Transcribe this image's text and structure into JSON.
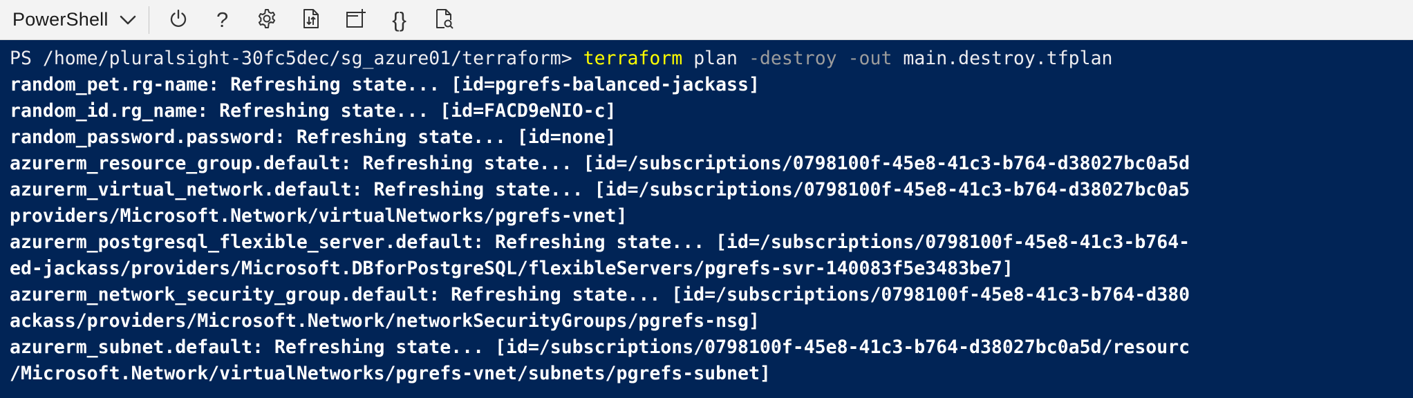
{
  "toolbar": {
    "shell_selector": "PowerShell",
    "buttons": [
      {
        "name": "restart-icon",
        "glyph": "power"
      },
      {
        "name": "help-icon",
        "glyph": "?"
      },
      {
        "name": "settings-icon",
        "glyph": "gear"
      },
      {
        "name": "upload-download-icon",
        "glyph": "file-transfer"
      },
      {
        "name": "new-session-icon",
        "glyph": "new-tab"
      },
      {
        "name": "editor-icon",
        "glyph": "{}"
      },
      {
        "name": "web-preview-icon",
        "glyph": "preview"
      }
    ]
  },
  "terminal": {
    "prompt": "PS /home/pluralsight-30fc5dec/sg_azure01/terraform> ",
    "command": {
      "name": "terraform",
      "arg1": " plan ",
      "flag1": "-destroy",
      "space": " ",
      "flag2": "-out",
      "arg2": " main.destroy.tfplan"
    },
    "lines": [
      "random_pet.rg-name: Refreshing state... [id=pgrefs-balanced-jackass]",
      "random_id.rg_name: Refreshing state... [id=FACD9eNIO-c]",
      "random_password.password: Refreshing state... [id=none]",
      "azurerm_resource_group.default: Refreshing state... [id=/subscriptions/0798100f-45e8-41c3-b764-d38027bc0a5d",
      "azurerm_virtual_network.default: Refreshing state... [id=/subscriptions/0798100f-45e8-41c3-b764-d38027bc0a5",
      "providers/Microsoft.Network/virtualNetworks/pgrefs-vnet]",
      "azurerm_postgresql_flexible_server.default: Refreshing state... [id=/subscriptions/0798100f-45e8-41c3-b764-",
      "ed-jackass/providers/Microsoft.DBforPostgreSQL/flexibleServers/pgrefs-svr-140083f5e3483be7]",
      "azurerm_network_security_group.default: Refreshing state... [id=/subscriptions/0798100f-45e8-41c3-b764-d380",
      "ackass/providers/Microsoft.Network/networkSecurityGroups/pgrefs-nsg]",
      "azurerm_subnet.default: Refreshing state... [id=/subscriptions/0798100f-45e8-41c3-b764-d38027bc0a5d/resourc",
      "/Microsoft.Network/virtualNetworks/pgrefs-vnet/subnets/pgrefs-subnet]"
    ]
  },
  "colors": {
    "terminal_bg": "#012456",
    "command_name": "#ffff00",
    "flag": "#9c9c9c",
    "text": "#ffffff",
    "toolbar_bg": "#f3f3f3"
  }
}
